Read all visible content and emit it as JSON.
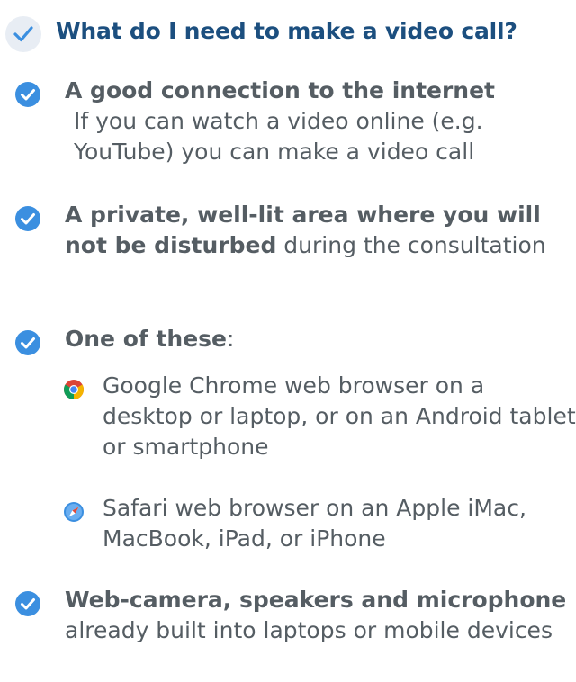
{
  "heading": "What do I need to make a video call?",
  "items": [
    {
      "bold": "A good connection to the internet",
      "rest": "If you can watch a video online (e.g. YouTube) you can make a video call"
    },
    {
      "bold": "A private, well-lit area where you will not be disturbed",
      "rest": " during the consultation"
    },
    {
      "bold": "One of these",
      "rest": ":"
    },
    {
      "bold": "Web-camera, speakers and microphone",
      "rest": " already built into laptops or mobile devices"
    }
  ],
  "browsers": [
    {
      "icon": "chrome-icon",
      "text": "Google Chrome web browser on a desktop or laptop, or on an Android tablet or smartphone"
    },
    {
      "icon": "safari-icon",
      "text": "Safari web browser on an Apple iMac, MacBook, iPad, or iPhone"
    }
  ],
  "colors": {
    "heading": "#1c4f7f",
    "check": "#3b8fe0",
    "text": "#555d63",
    "badge": "#e8edf4"
  }
}
